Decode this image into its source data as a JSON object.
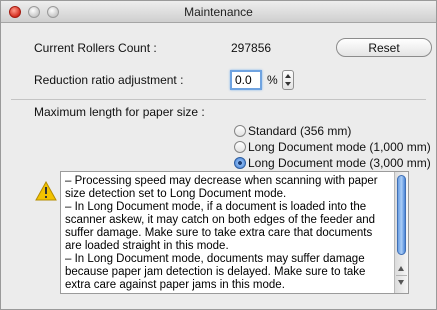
{
  "window": {
    "title": "Maintenance"
  },
  "rollers": {
    "label": "Current Rollers Count :",
    "value": "297856",
    "reset_label": "Reset"
  },
  "reduction": {
    "label": "Reduction ratio adjustment :",
    "value": "0.0",
    "unit": "%"
  },
  "paper_size": {
    "label": "Maximum length for paper size :",
    "options": [
      {
        "label": "Standard (356 mm)",
        "selected": false
      },
      {
        "label": "Long Document mode (1,000 mm)",
        "selected": false
      },
      {
        "label": "Long Document mode (3,000 mm)",
        "selected": true
      }
    ]
  },
  "notes": {
    "text": "– Processing speed may decrease when scanning with paper size detection set to Long Document mode.\n– In Long Document mode, if a document is loaded into the scanner askew, it may catch on both edges of the feeder and suffer damage. Make sure to take extra care that documents are loaded straight in this mode.\n– In Long Document mode, documents may suffer damage because paper jam detection is delayed. Make sure to take extra care against paper jams in this mode."
  },
  "icons": {
    "warning": "warning-icon",
    "accent": "#3c7bd6",
    "warning_color": "#f2c200"
  }
}
